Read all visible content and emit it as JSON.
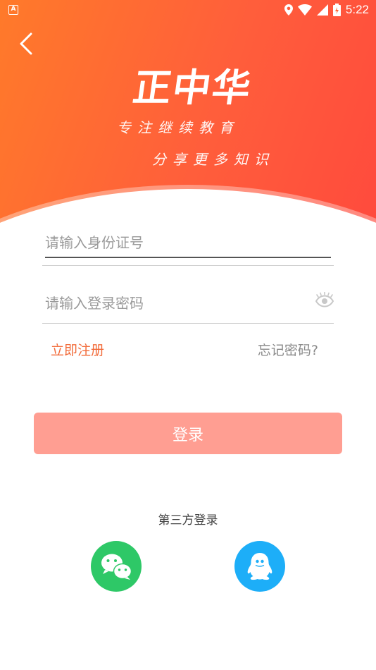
{
  "status_bar": {
    "time": "5:22",
    "app_icon_letter": "A"
  },
  "header": {
    "brand": "正中华",
    "slogan_line1": "专注继续教育",
    "slogan_line2": "分享更多知识"
  },
  "form": {
    "id_placeholder": "请输入身份证号",
    "password_placeholder": "请输入登录密码",
    "register_label": "立即注册",
    "forgot_label": "忘记密码?",
    "login_label": "登录"
  },
  "social": {
    "title": "第三方登录",
    "options": [
      "wechat-icon",
      "qq-icon"
    ]
  },
  "colors": {
    "header_start": "#ff7a2a",
    "header_end": "#ff4a3d",
    "accent": "#f26b3a",
    "login_button": "#ff9e92",
    "wechat": "#2ec867",
    "qq": "#1daef8"
  }
}
